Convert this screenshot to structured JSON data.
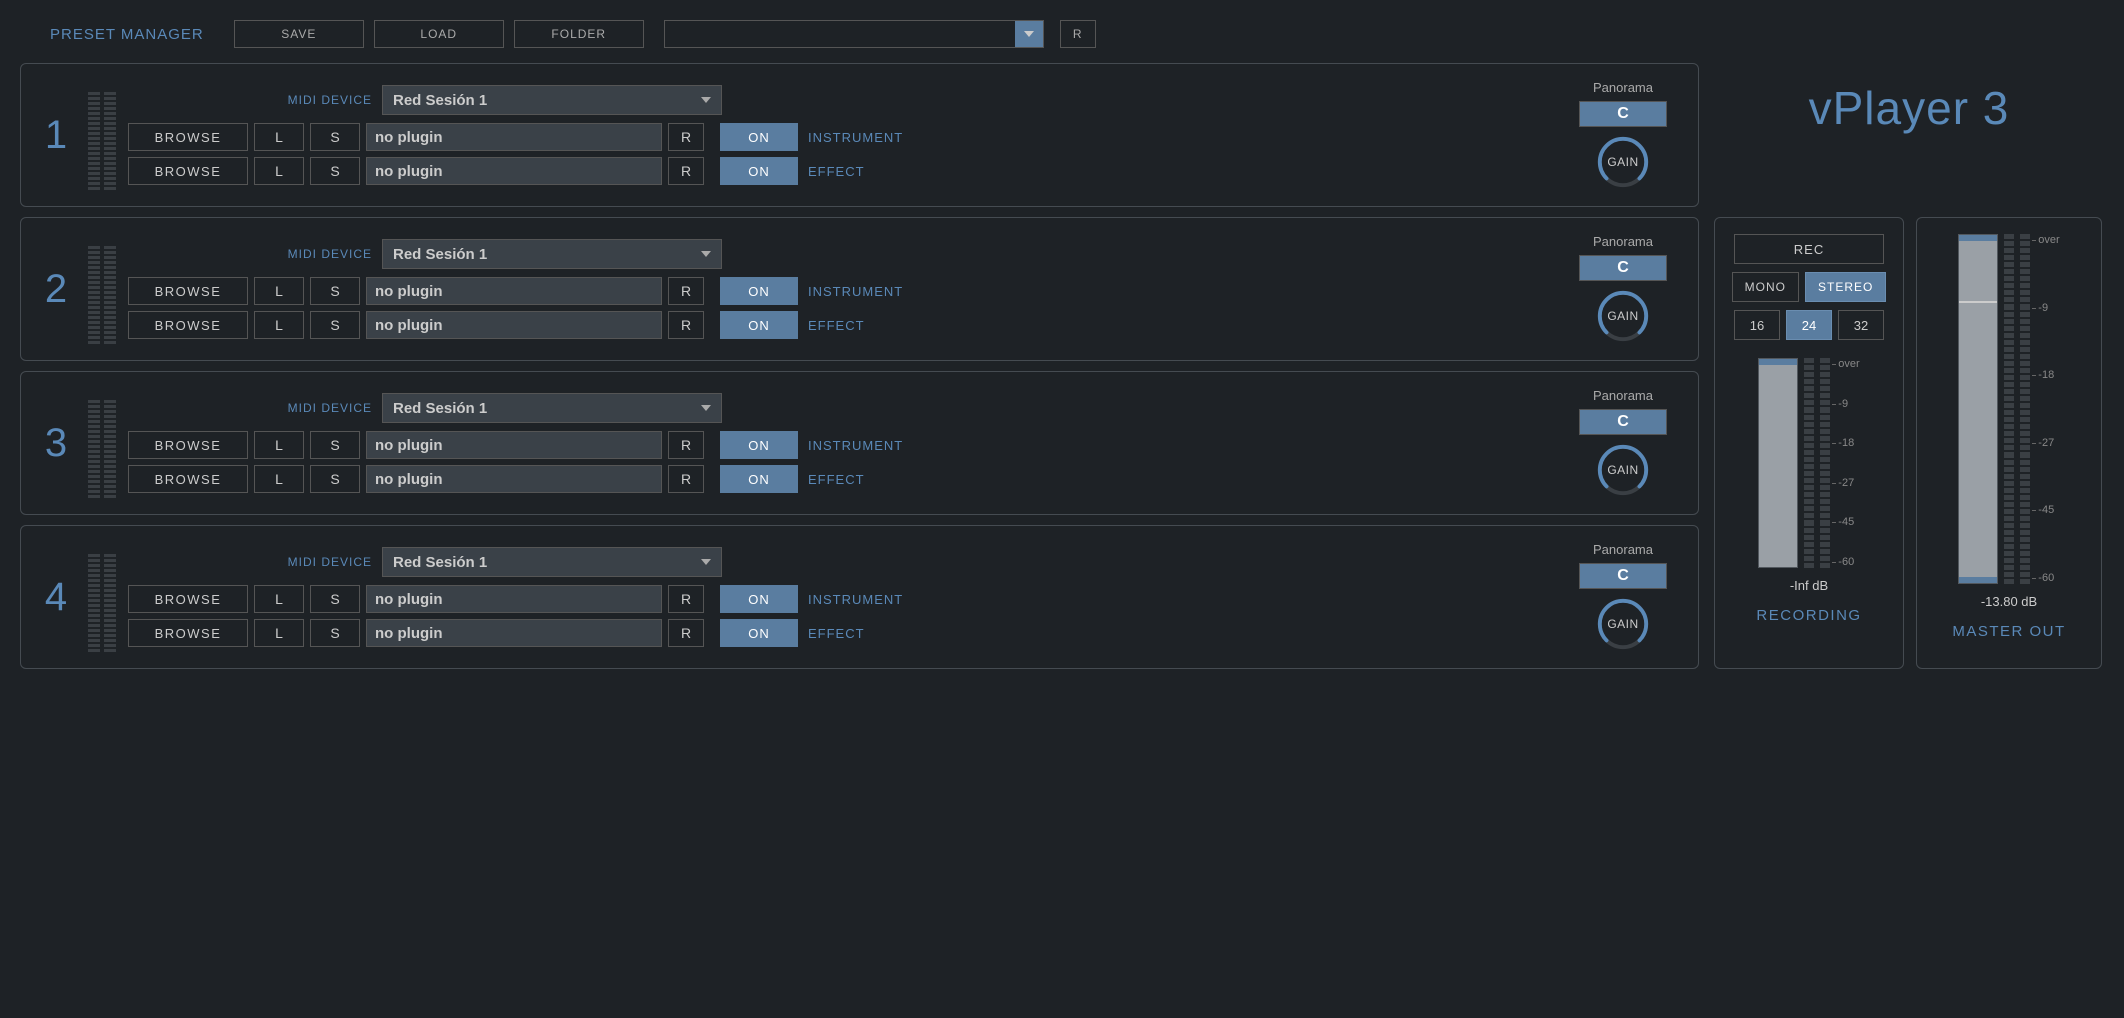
{
  "preset": {
    "label": "PRESET MANAGER",
    "save": "SAVE",
    "load": "LOAD",
    "folder": "FOLDER",
    "r": "R"
  },
  "app_title": "vPlayer 3",
  "labels": {
    "midi_device": "MIDI DEVICE",
    "browse": "BROWSE",
    "L": "L",
    "S": "S",
    "R": "R",
    "on": "ON",
    "instrument": "INSTRUMENT",
    "effect": "EFFECT",
    "panorama": "Panorama",
    "gain": "GAIN"
  },
  "channels": [
    {
      "num": "1",
      "midi": "Red Sesión 1",
      "instrument_plugin": "no plugin",
      "effect_plugin": "no plugin",
      "pan": "C"
    },
    {
      "num": "2",
      "midi": "Red Sesión 1",
      "instrument_plugin": "no plugin",
      "effect_plugin": "no plugin",
      "pan": "C"
    },
    {
      "num": "3",
      "midi": "Red Sesión 1",
      "instrument_plugin": "no plugin",
      "effect_plugin": "no plugin",
      "pan": "C"
    },
    {
      "num": "4",
      "midi": "Red Sesión 1",
      "instrument_plugin": "no plugin",
      "effect_plugin": "no plugin",
      "pan": "C"
    }
  ],
  "recording": {
    "rec": "REC",
    "mono": "MONO",
    "stereo": "STEREO",
    "stereo_active": true,
    "bits": [
      "16",
      "24",
      "32"
    ],
    "bits_active": "24",
    "scale": [
      "over",
      "-9",
      "-18",
      "-27",
      "-45",
      "-60"
    ],
    "db": "-Inf dB",
    "title": "RECORDING"
  },
  "master": {
    "scale": [
      "over",
      "-9",
      "-18",
      "-27",
      "-45",
      "-60"
    ],
    "db": "-13.80 dB",
    "title": "MASTER OUT"
  }
}
